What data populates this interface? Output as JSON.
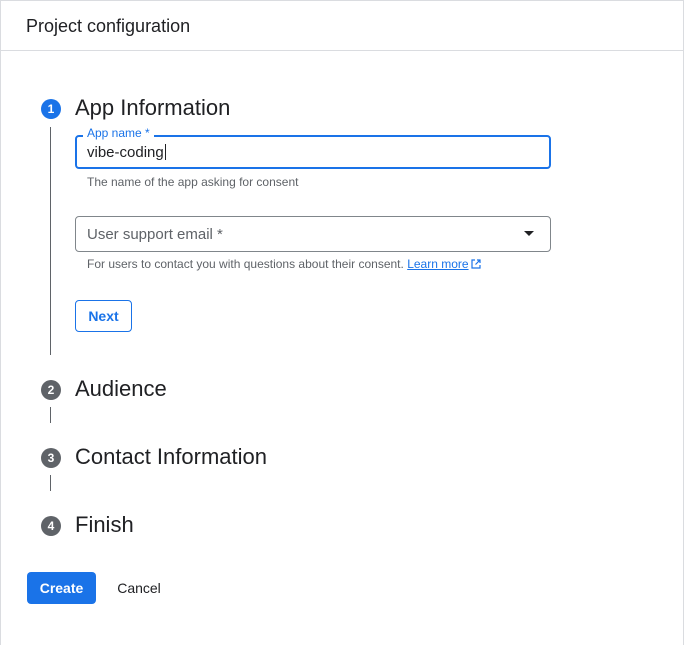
{
  "header": {
    "title": "Project configuration"
  },
  "steps": [
    {
      "number": "1",
      "title": "App Information",
      "state": "active"
    },
    {
      "number": "2",
      "title": "Audience",
      "state": "inactive"
    },
    {
      "number": "3",
      "title": "Contact Information",
      "state": "inactive"
    },
    {
      "number": "4",
      "title": "Finish",
      "state": "inactive"
    }
  ],
  "app_information": {
    "app_name": {
      "label": "App name *",
      "value": "vibe-coding",
      "helper": "The name of the app asking for consent"
    },
    "support_email": {
      "placeholder": "User support email *",
      "helper": "For users to contact you with questions about their consent.",
      "link_text": "Learn more"
    },
    "next_label": "Next"
  },
  "actions": {
    "create_label": "Create",
    "cancel_label": "Cancel"
  },
  "colors": {
    "accent": "#1a73e8",
    "inactive_step": "#5f6368",
    "border": "#dadce0"
  },
  "icons": {
    "dropdown": "arrow-drop-down-icon",
    "external_link": "open-in-new-icon"
  }
}
